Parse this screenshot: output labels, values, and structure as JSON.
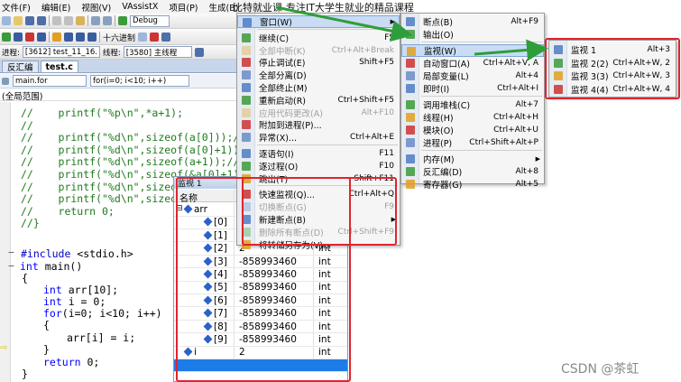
{
  "banner": "比特就业课-专注IT大学生就业的精品课程",
  "menubar": [
    "文件(F)",
    "编辑(E)",
    "视图(V)",
    "VAssistX",
    "项目(P)",
    "生成(B)"
  ],
  "toolbar": {
    "config": "Debug",
    "hex_label": "十六进制",
    "process_label": "进程:",
    "process_value": "[3612] test_11_16.",
    "thread_label": "线程:",
    "thread_value": "[3580] 主线程"
  },
  "tabs": [
    "反汇编",
    "test.c"
  ],
  "navbar": {
    "file": "main.for",
    "scope": "for(i=0; i<10; i++)"
  },
  "scope_label": "(全局范围)",
  "code_lines": [
    {
      "text": "//    printf(\"%p\\n\",*a+1);",
      "cls": "cm"
    },
    {
      "text": "//",
      "cls": "cm"
    },
    {
      "text": "//    printf(\"%d\\n\",sizeof(a[0]));//16",
      "cls": "cm"
    },
    {
      "text": "//    printf(\"%d\\n\",sizeof(a[0]+1));//4",
      "cls": "cm"
    },
    {
      "text": "//    printf(\"%d\\n\",sizeof(a+1));//4",
      "cls": "cm"
    },
    {
      "text": "//    printf(\"%d\\n\",sizeof(&a[0]+1));//",
      "cls": "cm"
    },
    {
      "text": "//    printf(\"%d\\n\",sizeof(",
      "cls": "cm"
    },
    {
      "text": "//    printf(\"%d\\n\",sizeof(",
      "cls": "cm"
    },
    {
      "text": "//    return 0;",
      "cls": "cm"
    },
    {
      "text": "//}",
      "cls": "cm"
    }
  ],
  "code2": {
    "include_kw": "#include",
    "include_hdr": " <stdio.h>",
    "main_kw": "int",
    "main_rest": " main()",
    "brace_open": "{",
    "l1_kw": "int",
    "l1_rest": " arr[10];",
    "l2_kw": "int",
    "l2_rest": " i = 0;",
    "l3_kw": "for",
    "l3_rest": "(i=0; i<10; i++)",
    "l4": "{",
    "l5": "arr[i] = i;",
    "l6": "}",
    "l7_kw": "return",
    "l7_rest": " 0;",
    "brace_close": "}"
  },
  "debug_menu": [
    {
      "label": "窗口(W)",
      "key": "",
      "arrow": true,
      "hl": true
    },
    {
      "label": "继续(C)",
      "key": "F5"
    },
    {
      "label": "全部中断(K)",
      "key": "Ctrl+Alt+Break",
      "disabled": true
    },
    {
      "label": "停止调试(E)",
      "key": "Shift+F5"
    },
    {
      "label": "全部分离(D)",
      "key": ""
    },
    {
      "label": "全部终止(M)",
      "key": ""
    },
    {
      "label": "重新启动(R)",
      "key": "Ctrl+Shift+F5"
    },
    {
      "label": "应用代码更改(A)",
      "key": "Alt+F10",
      "disabled": true
    },
    {
      "label": "附加到进程(P)...",
      "key": ""
    },
    {
      "label": "异常(X)...",
      "key": "Ctrl+Alt+E"
    },
    {
      "label": "逐语句(I)",
      "key": "F11"
    },
    {
      "label": "逐过程(O)",
      "key": "F10"
    },
    {
      "label": "跳出(T)",
      "key": "Shift+F11"
    },
    {
      "label": "快速监视(Q)...",
      "key": "Ctrl+Alt+Q"
    },
    {
      "label": "切换断点(G)",
      "key": "F9",
      "disabled": true
    },
    {
      "label": "新建断点(B)",
      "key": "",
      "arrow": true
    },
    {
      "label": "删除所有断点(D)",
      "key": "Ctrl+Shift+F9",
      "disabled": true
    },
    {
      "label": "将转储另存为(V)...",
      "key": ""
    }
  ],
  "window_menu": [
    {
      "label": "断点(B)",
      "key": "Alt+F9"
    },
    {
      "label": "输出(O)",
      "key": ""
    },
    {
      "label": "监视(W)",
      "key": "",
      "arrow": true,
      "hl": true
    },
    {
      "label": "自动窗口(A)",
      "key": "Ctrl+Alt+V, A"
    },
    {
      "label": "局部变量(L)",
      "key": "Alt+4"
    },
    {
      "label": "即时(I)",
      "key": "Ctrl+Alt+I"
    },
    {
      "label": "调用堆栈(C)",
      "key": "Alt+7"
    },
    {
      "label": "线程(H)",
      "key": "Ctrl+Alt+H"
    },
    {
      "label": "模块(O)",
      "key": "Ctrl+Alt+U"
    },
    {
      "label": "进程(P)",
      "key": "Ctrl+Shift+Alt+P"
    },
    {
      "label": "内存(M)",
      "key": "",
      "arrow": true
    },
    {
      "label": "反汇编(D)",
      "key": "Alt+8"
    },
    {
      "label": "寄存器(G)",
      "key": "Alt+5"
    }
  ],
  "watch_submenu": [
    {
      "label": "监视 1",
      "key": "Alt+3"
    },
    {
      "label": "监视 2(2)",
      "key": "Ctrl+Alt+W, 2"
    },
    {
      "label": "监视 3(3)",
      "key": "Ctrl+Alt+W, 3"
    },
    {
      "label": "监视 4(4)",
      "key": "Ctrl+Alt+W, 4"
    }
  ],
  "watch_window": {
    "title": "监视 1",
    "col_name": "名称",
    "rows": [
      {
        "name": "arr",
        "value": "",
        "type": "",
        "level": 0,
        "expanded": true
      },
      {
        "name": "[0]",
        "value": "",
        "type": "",
        "level": 1
      },
      {
        "name": "[1]",
        "value": "",
        "type": "",
        "level": 1
      },
      {
        "name": "[2]",
        "value": "2",
        "type": "int",
        "level": 1
      },
      {
        "name": "[3]",
        "value": "-858993460",
        "type": "int",
        "level": 1
      },
      {
        "name": "[4]",
        "value": "-858993460",
        "type": "int",
        "level": 1
      },
      {
        "name": "[5]",
        "value": "-858993460",
        "type": "int",
        "level": 1
      },
      {
        "name": "[6]",
        "value": "-858993460",
        "type": "int",
        "level": 1
      },
      {
        "name": "[7]",
        "value": "-858993460",
        "type": "int",
        "level": 1
      },
      {
        "name": "[8]",
        "value": "-858993460",
        "type": "int",
        "level": 1
      },
      {
        "name": "[9]",
        "value": "-858993460",
        "type": "int",
        "level": 1
      },
      {
        "name": "i",
        "value": "2",
        "type": "int",
        "level": 0
      },
      {
        "name": "",
        "value": "",
        "type": "",
        "level": 0,
        "selected": true
      }
    ]
  },
  "watermark": "CSDN @茶虹",
  "colors": {
    "highlight_red": "#e0242f",
    "arrow_green": "#2e9e3a",
    "menu_highlight": "#c9dcf3"
  }
}
